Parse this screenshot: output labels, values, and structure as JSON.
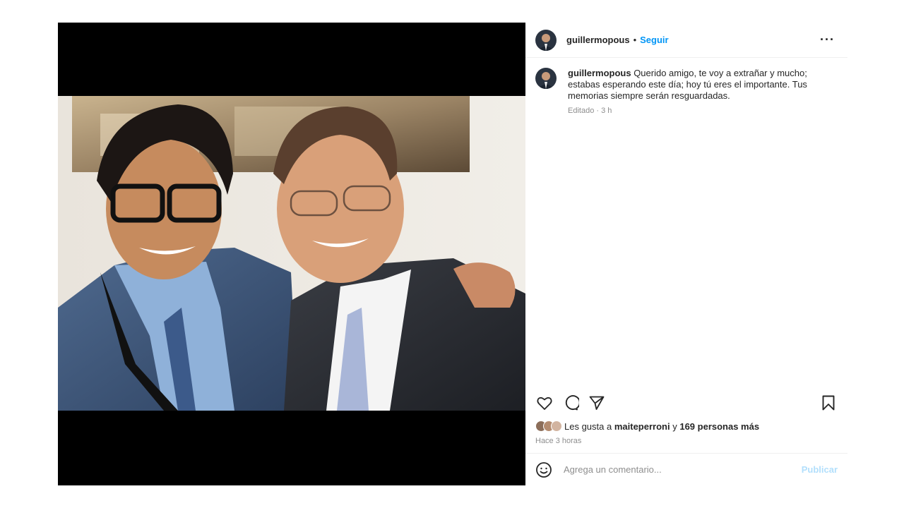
{
  "post": {
    "username": "guillermopous",
    "separator": "•",
    "follow_label": "Seguir",
    "more_icon": "more-horizontal-icon",
    "caption_text": "Querido amigo, te voy a extrañar y mucho; estabas esperando este día; hoy tú eres el importante. Tus memorias siempre serán resguardadas.",
    "caption_meta": "Editado · 3 h",
    "likes_prefix": "Les gusta a ",
    "likes_user": "maiteperroni",
    "likes_middle": " y ",
    "likes_count": "169 personas más",
    "time": "Hace 3 horas",
    "comment_placeholder": "Agrega un comentario...",
    "publish_label": "Publicar"
  },
  "icons": [
    "heart-icon",
    "comment-icon",
    "share-icon",
    "bookmark-icon",
    "emoji-icon"
  ],
  "colors": {
    "link": "#0095f6",
    "publish_disabled": "#b2dffc",
    "text": "#262626",
    "muted": "#8e8e8e",
    "media_bg": "#000000"
  }
}
